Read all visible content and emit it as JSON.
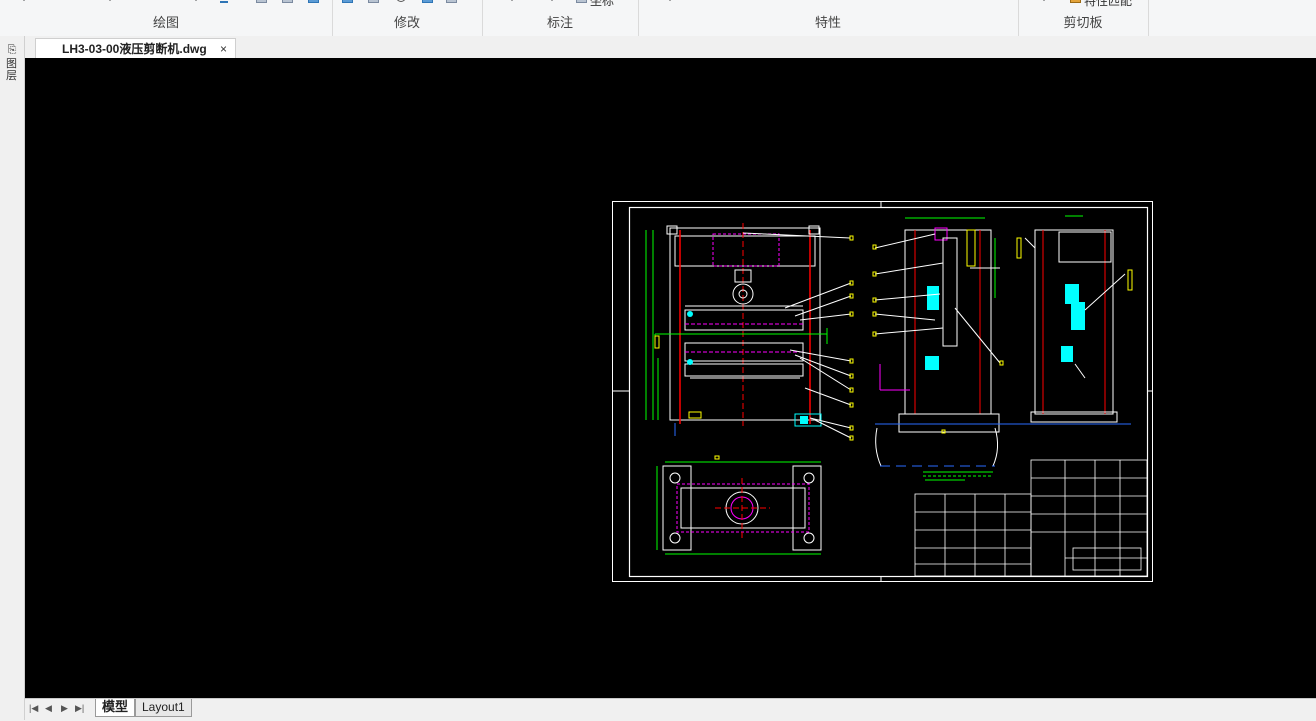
{
  "ribbon": {
    "groups": [
      {
        "label": "绘图"
      },
      {
        "label": "修改"
      },
      {
        "label": "标注"
      },
      {
        "label": "特性"
      },
      {
        "label": "剪切板"
      }
    ],
    "partial_labels": {
      "dimension_text": "坐标",
      "clipboard_text": "特性匹配"
    }
  },
  "left_palette": {
    "label": "图层"
  },
  "document_tab": {
    "title": "LH3-03-00液压剪断机.dwg",
    "close_glyph": "×"
  },
  "layout_tabs": {
    "nav": [
      "|◀",
      "◀",
      "▶",
      "▶|"
    ],
    "tabs": [
      {
        "label": "模型",
        "active": true
      },
      {
        "label": "Layout1",
        "active": false
      }
    ]
  },
  "colors": {
    "canvas_bg": "#000000",
    "frame": "#ffffff",
    "yellow": "#ffff00",
    "green": "#00ff00",
    "red": "#ff0000",
    "magenta": "#ff00ff",
    "cyan": "#00ffff",
    "blue": "#2a6cff"
  }
}
